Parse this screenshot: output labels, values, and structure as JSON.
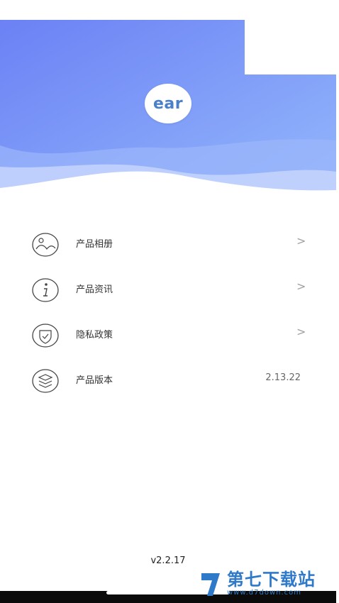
{
  "header": {
    "logo_text": "ear"
  },
  "menu": {
    "items": [
      {
        "label": "产品相册",
        "trailing": ">"
      },
      {
        "label": "产品资讯",
        "trailing": ">"
      },
      {
        "label": "隐私政策",
        "trailing": ">"
      },
      {
        "label": "产品版本",
        "value": "2.13.22"
      }
    ]
  },
  "footer": {
    "app_version": "v2.2.17"
  },
  "watermark": {
    "title": "第七下载站",
    "url": "www.d7down.com"
  },
  "colors": {
    "header_gradient_start": "#6f86f6",
    "header_gradient_end": "#8fb3fa",
    "logo_text": "#4a80c9",
    "watermark": "#2f79c9"
  },
  "icons": {
    "menu": [
      "album-icon",
      "info-icon",
      "shield-icon",
      "layers-icon"
    ]
  }
}
